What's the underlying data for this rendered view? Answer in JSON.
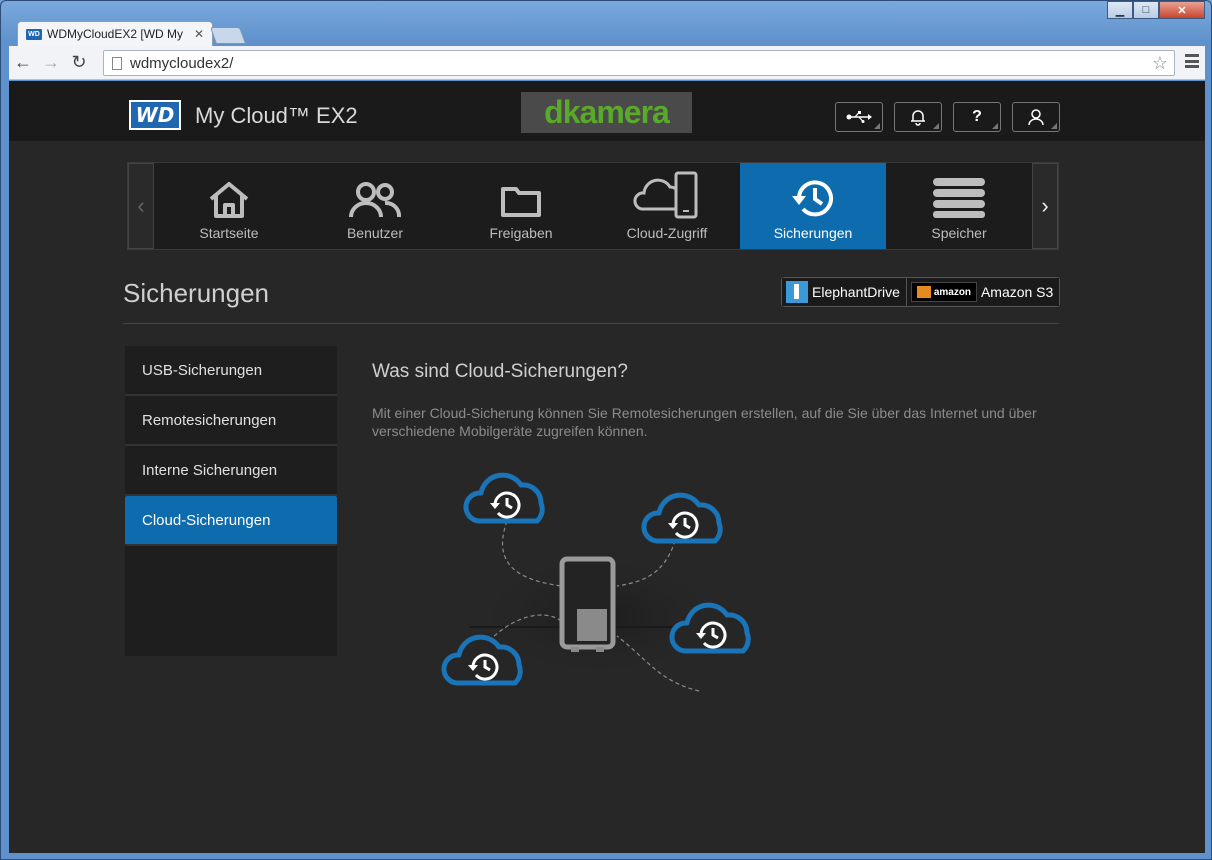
{
  "browser": {
    "tab_title": "WDMyCloudEX2 [WD My",
    "tab_favicon": "WD",
    "url": "wdmycloudex2/",
    "window_controls": {
      "minimize": "▁",
      "maximize": "□",
      "close": "✕"
    }
  },
  "header": {
    "logo": "WD",
    "product_name": "My Cloud™ EX2",
    "banner": "dkamera",
    "icons": [
      "usb-icon",
      "bell-icon",
      "help-icon",
      "user-icon"
    ],
    "help_label": "?"
  },
  "nav": {
    "items": [
      {
        "label": "Startseite",
        "icon": "home-icon"
      },
      {
        "label": "Benutzer",
        "icon": "users-icon"
      },
      {
        "label": "Freigaben",
        "icon": "folder-icon"
      },
      {
        "label": "Cloud-Zugriff",
        "icon": "cloud-device-icon"
      },
      {
        "label": "Sicherungen",
        "icon": "backup-icon",
        "active": true
      },
      {
        "label": "Speicher",
        "icon": "storage-icon"
      }
    ]
  },
  "page": {
    "title": "Sicherungen",
    "providers": [
      {
        "label": "ElephantDrive",
        "icon": "elephantdrive-icon"
      },
      {
        "label": "Amazon S3",
        "icon": "amazon-aws-icon",
        "logo_text": "amazon"
      }
    ]
  },
  "sidebar": {
    "items": [
      {
        "label": "USB-Sicherungen"
      },
      {
        "label": "Remotesicherungen"
      },
      {
        "label": "Interne Sicherungen"
      },
      {
        "label": "Cloud-Sicherungen",
        "active": true
      }
    ]
  },
  "content": {
    "title": "Was sind Cloud-Sicherungen?",
    "description": "Mit einer Cloud-Sicherung können Sie Remotesicherungen erstellen, auf die Sie über das Internet und über verschiedene Mobilgeräte zugreifen können."
  },
  "colors": {
    "accent": "#0e6bad",
    "page_bg": "#272727",
    "topbar_bg": "#1a1a1a",
    "cloud": "#1a74b8"
  }
}
